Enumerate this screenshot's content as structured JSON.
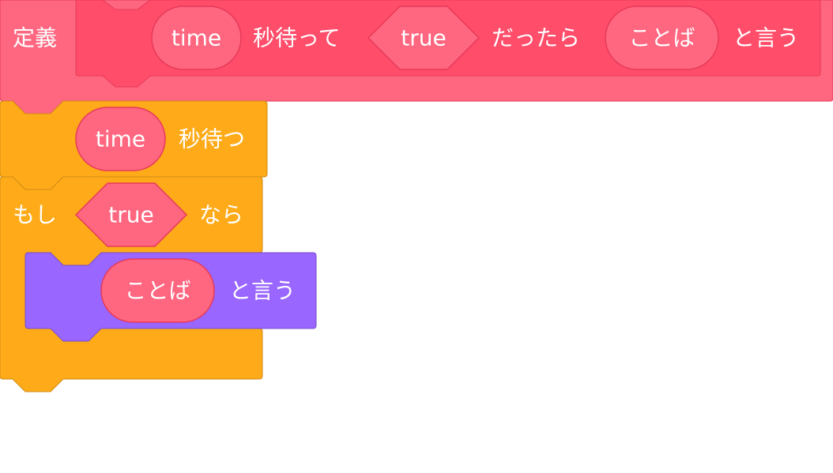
{
  "define_block": {
    "keyword": "定義",
    "params": {
      "time": "time",
      "wait_text": "秒待って",
      "bool": "true",
      "if_text": "だったら",
      "word": "ことば",
      "say_text": "と言う"
    }
  },
  "wait_block": {
    "arg": "time",
    "label": "秒待つ"
  },
  "if_block": {
    "prefix": "もし",
    "condition": "true",
    "suffix": "なら"
  },
  "say_block": {
    "arg": "ことば",
    "label": "と言う"
  },
  "colors": {
    "define_outer": "#FF6680",
    "define_inner": "#FF4D6A",
    "reporter": "#FF6680",
    "reporter_stroke": "#E63A5A",
    "control": "#FFAB19",
    "control_stroke": "#CF8B17",
    "looks": "#9966FF",
    "looks_stroke": "#774DCB"
  }
}
